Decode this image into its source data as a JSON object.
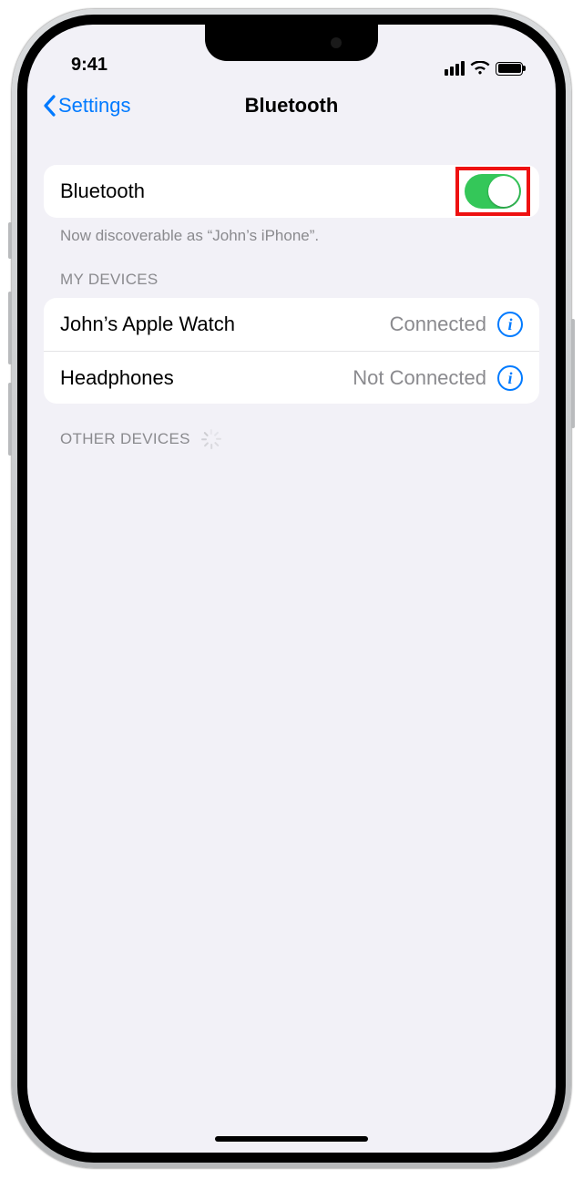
{
  "status_bar": {
    "time": "9:41"
  },
  "nav": {
    "back_label": "Settings",
    "title": "Bluetooth"
  },
  "bluetooth_row": {
    "label": "Bluetooth",
    "on": true
  },
  "discoverable_text": "Now discoverable as “John’s iPhone”.",
  "sections": {
    "my_devices_header": "MY DEVICES",
    "other_devices_header": "OTHER DEVICES"
  },
  "devices": [
    {
      "name": "John’s Apple Watch",
      "status": "Connected"
    },
    {
      "name": "Headphones",
      "status": "Not Connected"
    }
  ],
  "colors": {
    "tint": "#007aff",
    "toggle_on": "#34c759",
    "bg": "#f2f1f7",
    "highlight": "#e11"
  }
}
